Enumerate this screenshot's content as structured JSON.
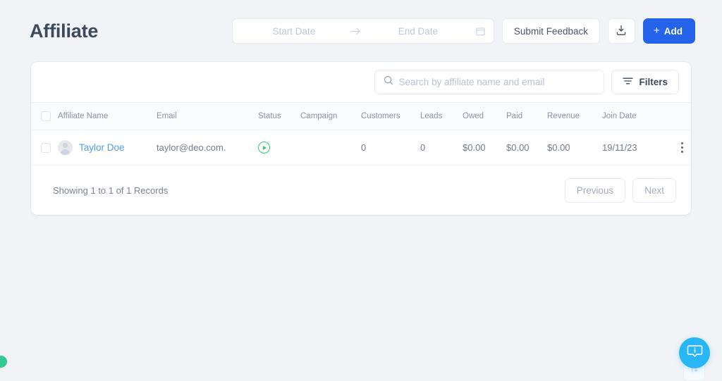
{
  "header": {
    "title": "Affiliate",
    "date_range": {
      "start_placeholder": "Start Date",
      "end_placeholder": "End Date",
      "arrow": "→",
      "calendar_icon": "calendar-icon"
    },
    "submit_feedback_label": "Submit Feedback",
    "download_icon": "download-icon",
    "add_label": "Add",
    "add_plus": "+",
    "add_color": "#2563eb"
  },
  "toolbar": {
    "search_placeholder": "Search by affiliate name and email",
    "search_value": "",
    "search_icon": "search-icon",
    "filters_label": "Filters",
    "filters_icon": "filter-icon"
  },
  "table": {
    "columns": [
      "Affiliate Name",
      "Email",
      "Status",
      "Campaign",
      "Customers",
      "Leads",
      "Owed",
      "Paid",
      "Revenue",
      "Join Date"
    ],
    "rows": [
      {
        "name": "Taylor Doe",
        "email": "taylor@deo.com.",
        "status": "active",
        "status_icon": "play-circle-icon",
        "campaign": "",
        "customers": "0",
        "leads": "0",
        "owed": "$0.00",
        "paid": "$0.00",
        "revenue": "$0.00",
        "join_date": "19/11/23"
      }
    ],
    "status_color": "#2ecc71",
    "name_link_color": "#4f9cf2"
  },
  "footer": {
    "records_text": "Showing 1 to 1 of 1 Records",
    "previous_label": "Previous",
    "next_label": "Next"
  },
  "widgets": {
    "chat_icon": "info-chat-bubble-icon",
    "chat_color": "#29b6f6",
    "sync_icon": "sync-arrows-icon",
    "status_dot_color": "#35c793"
  }
}
